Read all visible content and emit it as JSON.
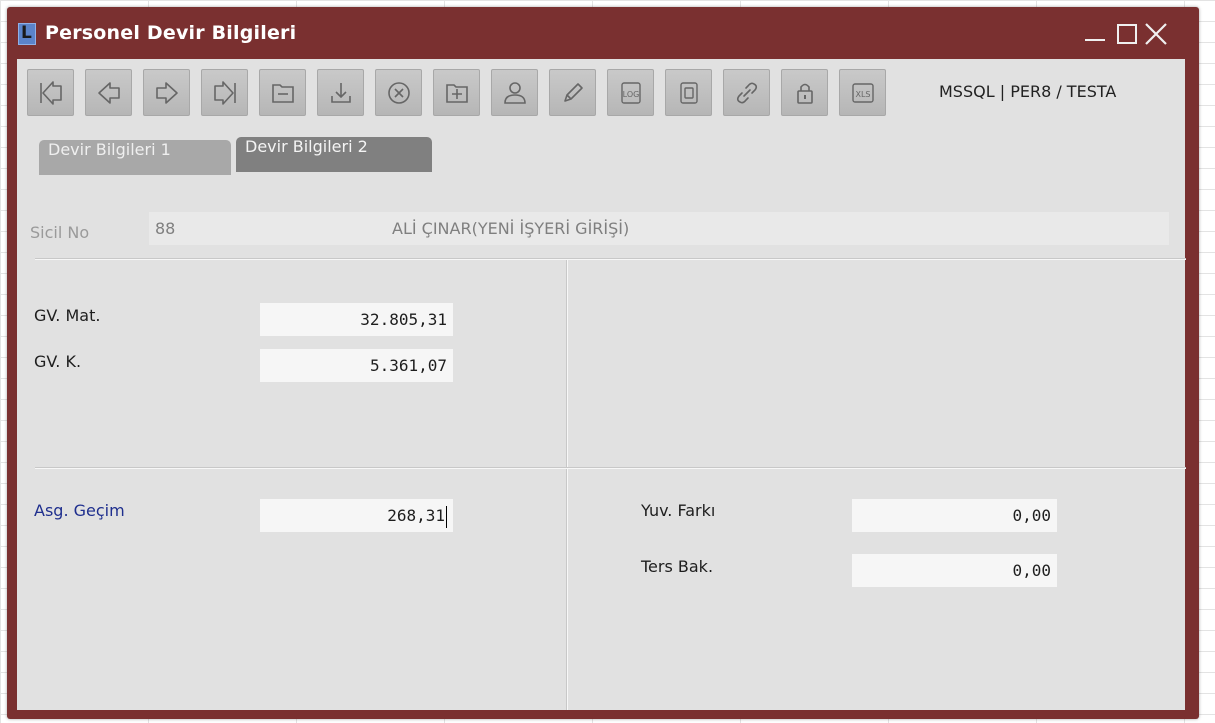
{
  "window": {
    "title": "Personel Devir Bilgileri"
  },
  "toolbar": {
    "buttons": [
      {
        "icon": "first-record-icon"
      },
      {
        "icon": "previous-record-icon"
      },
      {
        "icon": "next-record-icon"
      },
      {
        "icon": "last-record-icon"
      },
      {
        "icon": "minus-folder-icon"
      },
      {
        "icon": "download-icon"
      },
      {
        "icon": "cancel-icon"
      },
      {
        "icon": "add-folder-icon"
      },
      {
        "icon": "user-icon"
      },
      {
        "icon": "pencil-icon"
      },
      {
        "icon": "log-icon"
      },
      {
        "icon": "document-icon"
      },
      {
        "icon": "link-icon"
      },
      {
        "icon": "lock-icon"
      },
      {
        "icon": "xls-icon"
      }
    ],
    "connection": "MSSQL | PER8 / TESTA"
  },
  "tabs": [
    {
      "label": "Devir Bilgileri 1",
      "active": false
    },
    {
      "label": "Devir Bilgileri 2",
      "active": true
    }
  ],
  "header": {
    "sicil_label": "Sicil No",
    "sicil_value": "88",
    "person_name": "ALİ ÇINAR(YENİ İŞYERİ GİRİŞİ)"
  },
  "fields": {
    "gv_mat_label": "GV. Mat.",
    "gv_mat_value": "32.805,31",
    "gv_k_label": "GV. K.",
    "gv_k_value": "5.361,07",
    "asg_gecim_label": "Asg. Geçim",
    "asg_gecim_value": "268,31",
    "yuv_farki_label": "Yuv. Farkı",
    "yuv_farki_value": "0,00",
    "ters_bak_label": "Ters Bak.",
    "ters_bak_value": "0,00"
  },
  "colors": {
    "window_frame": "#7a3030",
    "client_bg": "#e1e1e1",
    "active_tab": "#808080",
    "inactive_tab": "#a8a8a8",
    "highlight_label": "#1f2f8e"
  }
}
